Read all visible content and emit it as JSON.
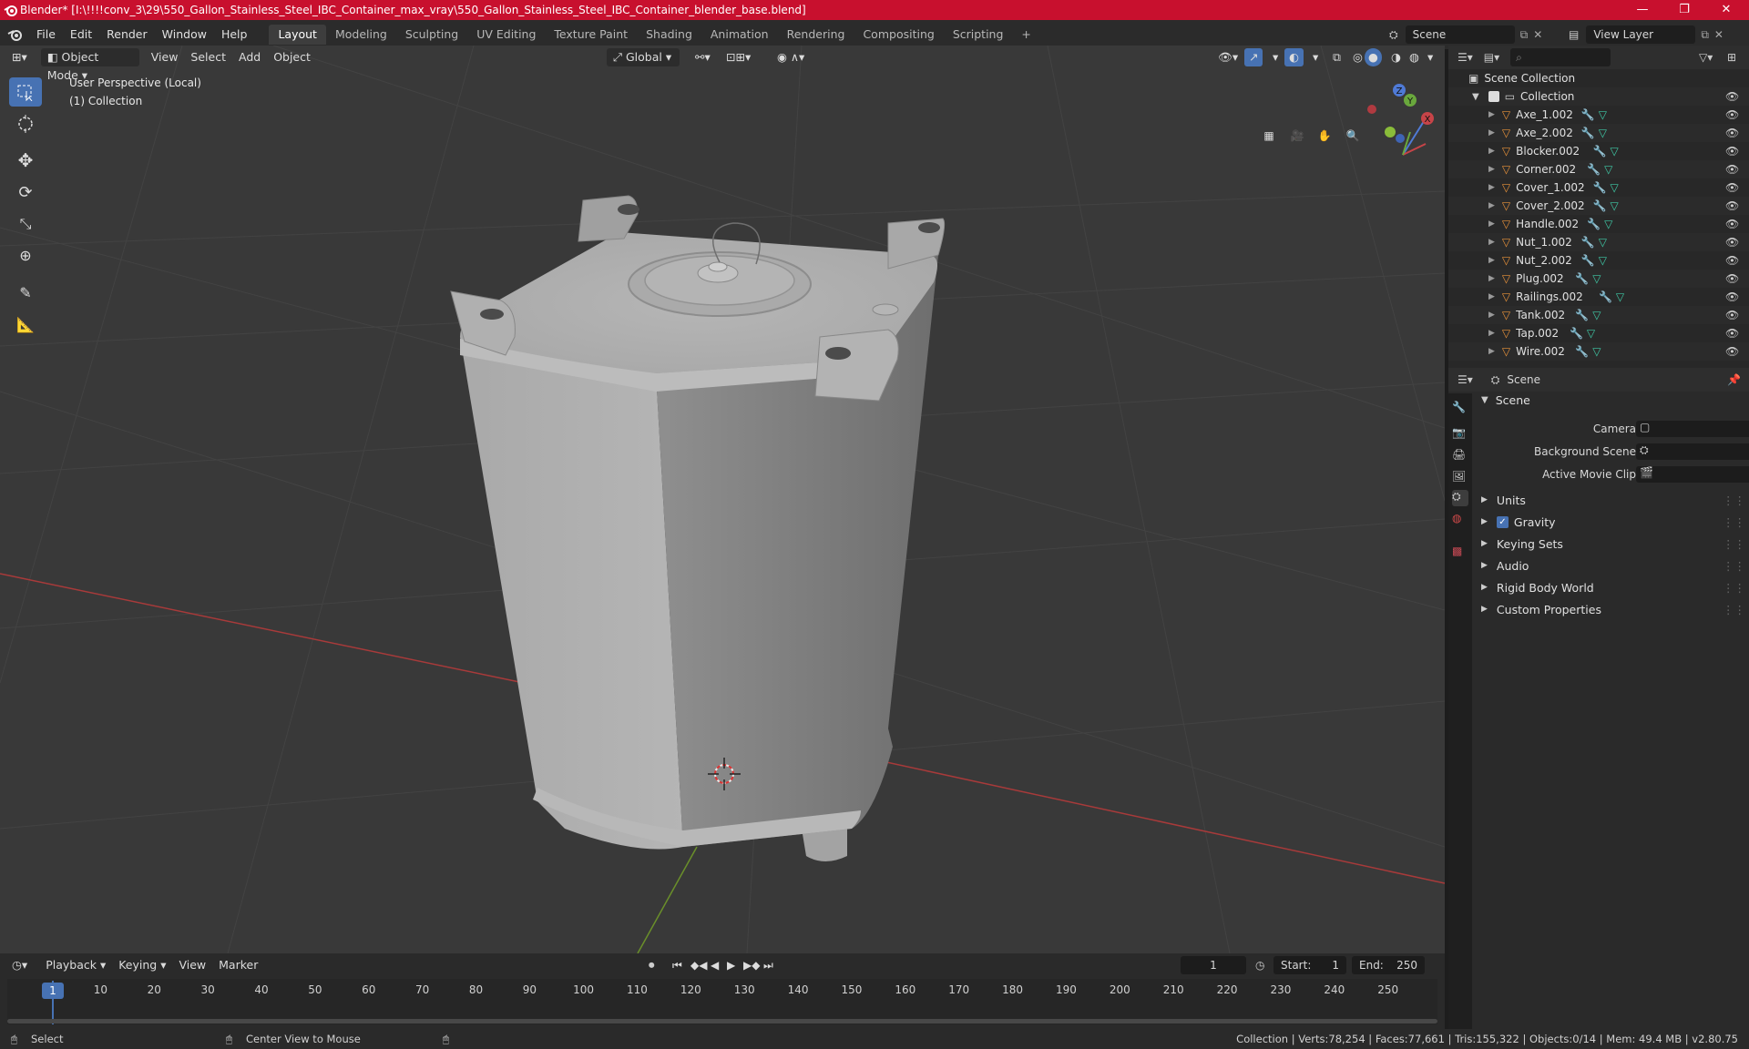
{
  "window": {
    "title": "Blender* [I:\\!!!!conv_3\\29\\550_Gallon_Stainless_Steel_IBC_Container_max_vray\\550_Gallon_Stainless_Steel_IBC_Container_blender_base.blend]",
    "minimize": "—",
    "maximize": "❐",
    "close": "✕"
  },
  "menubar": {
    "menus": [
      "File",
      "Edit",
      "Render",
      "Window",
      "Help"
    ],
    "workspaces": [
      "Layout",
      "Modeling",
      "Sculpting",
      "UV Editing",
      "Texture Paint",
      "Shading",
      "Animation",
      "Rendering",
      "Compositing",
      "Scripting"
    ],
    "active_workspace": "Layout",
    "add_workspace": "+",
    "scene_label": "Scene",
    "view_layer_label": "View Layer"
  },
  "viewport": {
    "mode": "Object Mode",
    "menus": [
      "View",
      "Select",
      "Add",
      "Object"
    ],
    "transform_orientation": "Global",
    "overlay_line1": "User Perspective (Local)",
    "overlay_line2": "(1) Collection",
    "gizmo_axes": {
      "x": "X",
      "y": "Y",
      "z": "Z"
    }
  },
  "outliner": {
    "search_placeholder": "",
    "root": "Scene Collection",
    "collection": "Collection",
    "objects": [
      "Axe_1.002",
      "Axe_2.002",
      "Blocker.002",
      "Corner.002",
      "Cover_1.002",
      "Cover_2.002",
      "Handle.002",
      "Nut_1.002",
      "Nut_2.002",
      "Plug.002",
      "Railings.002",
      "Tank.002",
      "Tap.002",
      "Wire.002"
    ]
  },
  "properties": {
    "header": "Scene",
    "panel_title": "Scene",
    "fields": [
      {
        "label": "Camera",
        "value": ""
      },
      {
        "label": "Background Scene",
        "value": ""
      },
      {
        "label": "Active Movie Clip",
        "value": ""
      }
    ],
    "subpanels": [
      "Units",
      "Gravity",
      "Keying Sets",
      "Audio",
      "Rigid Body World",
      "Custom Properties"
    ],
    "gravity_checked": true
  },
  "timeline": {
    "menus": [
      "Playback",
      "Keying",
      "View",
      "Marker"
    ],
    "current_frame": "1",
    "start_label": "Start:",
    "start_value": "1",
    "end_label": "End:",
    "end_value": "250",
    "ticks": [
      "1",
      "10",
      "20",
      "30",
      "40",
      "50",
      "60",
      "70",
      "80",
      "90",
      "100",
      "110",
      "120",
      "130",
      "140",
      "150",
      "160",
      "170",
      "180",
      "190",
      "200",
      "210",
      "220",
      "230",
      "240",
      "250"
    ]
  },
  "statusbar": {
    "left_action": "Select",
    "middle_action": "Center View to Mouse",
    "stats": "Collection | Verts:78,254 | Faces:77,661 | Tris:155,322 | Objects:0/14 | Mem: 49.4 MB | v2.80.75"
  },
  "colors": {
    "accent": "#4772b3",
    "titlebar": "#c8102e",
    "object_icon": "#e8923a",
    "mesh_icon": "#3fc9a6",
    "modifier_icon": "#6a9cf0"
  }
}
